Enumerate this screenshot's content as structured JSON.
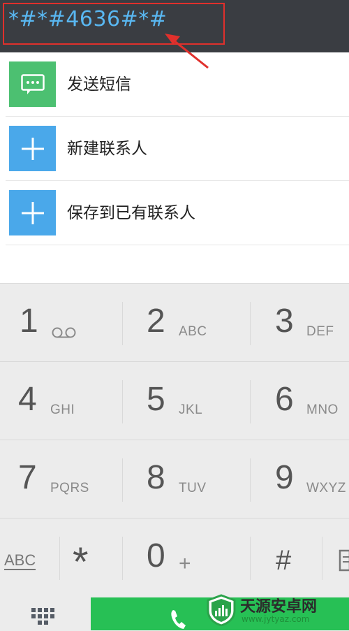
{
  "dialer": {
    "number": "*#*#4636#*#"
  },
  "options": [
    {
      "label": "发送短信",
      "icon": "message-icon",
      "color": "#4cc071"
    },
    {
      "label": "新建联系人",
      "icon": "plus-icon",
      "color": "#4aa8ea"
    },
    {
      "label": "保存到已有联系人",
      "icon": "plus-icon",
      "color": "#4aa8ea"
    }
  ],
  "keypad": {
    "rows": [
      [
        {
          "digit": "1",
          "letters": ""
        },
        {
          "digit": "2",
          "letters": "ABC"
        },
        {
          "digit": "3",
          "letters": "DEF"
        }
      ],
      [
        {
          "digit": "4",
          "letters": "GHI"
        },
        {
          "digit": "5",
          "letters": "JKL"
        },
        {
          "digit": "6",
          "letters": "MNO"
        }
      ],
      [
        {
          "digit": "7",
          "letters": "PQRS"
        },
        {
          "digit": "8",
          "letters": "TUV"
        },
        {
          "digit": "9",
          "letters": "WXYZ"
        }
      ]
    ],
    "bottom_row": {
      "abc_label": "ABC",
      "star": "*",
      "zero": "0",
      "plus": "+",
      "hash": "#"
    }
  },
  "colors": {
    "header_bg": "#3a3d42",
    "dial_text": "#59b7f1",
    "highlight": "#e0302c",
    "call_green": "#27c055"
  },
  "watermark": {
    "title": "天源安卓网",
    "url": "www.jytyaz.com"
  }
}
